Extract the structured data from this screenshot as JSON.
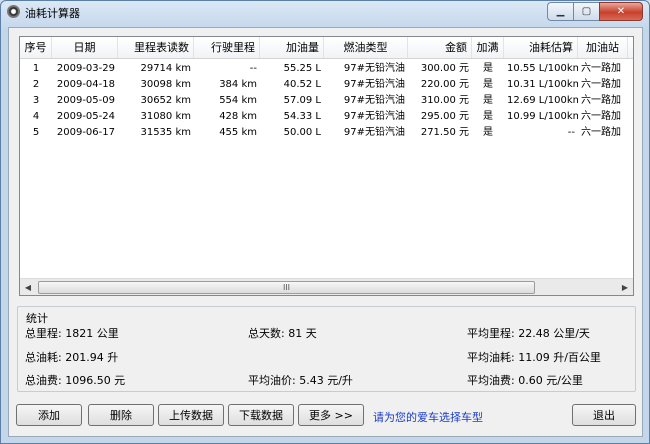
{
  "window": {
    "title": "油耗计算器",
    "min_icon": "minimize-icon",
    "max_icon": "maximize-icon",
    "close_icon": "close-icon"
  },
  "columns": [
    "序号",
    "日期",
    "里程表读数",
    "行驶里程",
    "加油量",
    "燃油类型",
    "金额",
    "加满",
    "油耗估算",
    "加油站"
  ],
  "rows": [
    [
      "1",
      "2009-03-29",
      "29714 km",
      "--",
      "55.25 L",
      "97#无铅汽油",
      "300.00 元",
      "是",
      "10.55 L/100km",
      "六一路加"
    ],
    [
      "2",
      "2009-04-18",
      "30098 km",
      "384 km",
      "40.52 L",
      "97#无铅汽油",
      "220.00 元",
      "是",
      "10.31 L/100km",
      "六一路加"
    ],
    [
      "3",
      "2009-05-09",
      "30652 km",
      "554 km",
      "57.09 L",
      "97#无铅汽油",
      "310.00 元",
      "是",
      "12.69 L/100km",
      "六一路加"
    ],
    [
      "4",
      "2009-05-24",
      "31080 km",
      "428 km",
      "54.33 L",
      "97#无铅汽油",
      "295.00 元",
      "是",
      "10.99 L/100km",
      "六一路加"
    ],
    [
      "5",
      "2009-06-17",
      "31535 km",
      "455 km",
      "50.00 L",
      "97#无铅汽油",
      "271.50 元",
      "是",
      "--",
      "六一路加"
    ]
  ],
  "scrollbar": {
    "left_arrow": "◀",
    "right_arrow": "▶",
    "grip": "III"
  },
  "stats": {
    "title": "统计",
    "total_mileage": "总里程: 1821 公里",
    "total_days": "总天数: 81 天",
    "avg_mileage": "平均里程: 22.48 公里/天",
    "total_fuel": "总油耗: 201.94 升",
    "avg_fuel": "平均油耗: 11.09 升/百公里",
    "total_cost": "总油费: 1096.50 元",
    "avg_price": "平均油价: 5.43 元/升",
    "avg_cost": "平均油费: 0.60 元/公里"
  },
  "buttons": {
    "add": "添加",
    "delete": "删除",
    "upload": "上传数据",
    "download": "下载数据",
    "more": "更多 >>",
    "exit": "退出"
  },
  "hint": "请为您的爱车选择车型"
}
